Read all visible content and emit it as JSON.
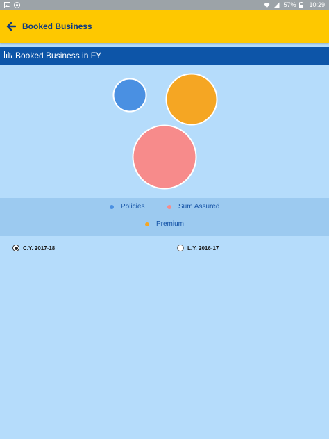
{
  "status_bar": {
    "battery": "57%",
    "time": "10:29",
    "icons": [
      "gallery-icon",
      "cast-icon",
      "wifi-icon",
      "signal-icon",
      "battery-icon"
    ]
  },
  "app_bar": {
    "title": "Booked Business",
    "back_icon": "arrow-left-icon",
    "background": "#fec800"
  },
  "section": {
    "title": "Booked Business in FY",
    "icon": "bar-chart-icon",
    "background": "#0d55a8"
  },
  "chart_data": {
    "type": "bubble",
    "series": [
      {
        "name": "Policies",
        "color": "#4a90e2"
      },
      {
        "name": "Sum Assured",
        "color": "#f78b8b"
      },
      {
        "name": "Premium",
        "color": "#f5a623"
      }
    ],
    "legend_position": "bottom"
  },
  "filters": {
    "options": [
      {
        "label": "C.Y. 2017-18",
        "selected": true
      },
      {
        "label": "L.Y. 2016-17",
        "selected": false
      }
    ]
  }
}
